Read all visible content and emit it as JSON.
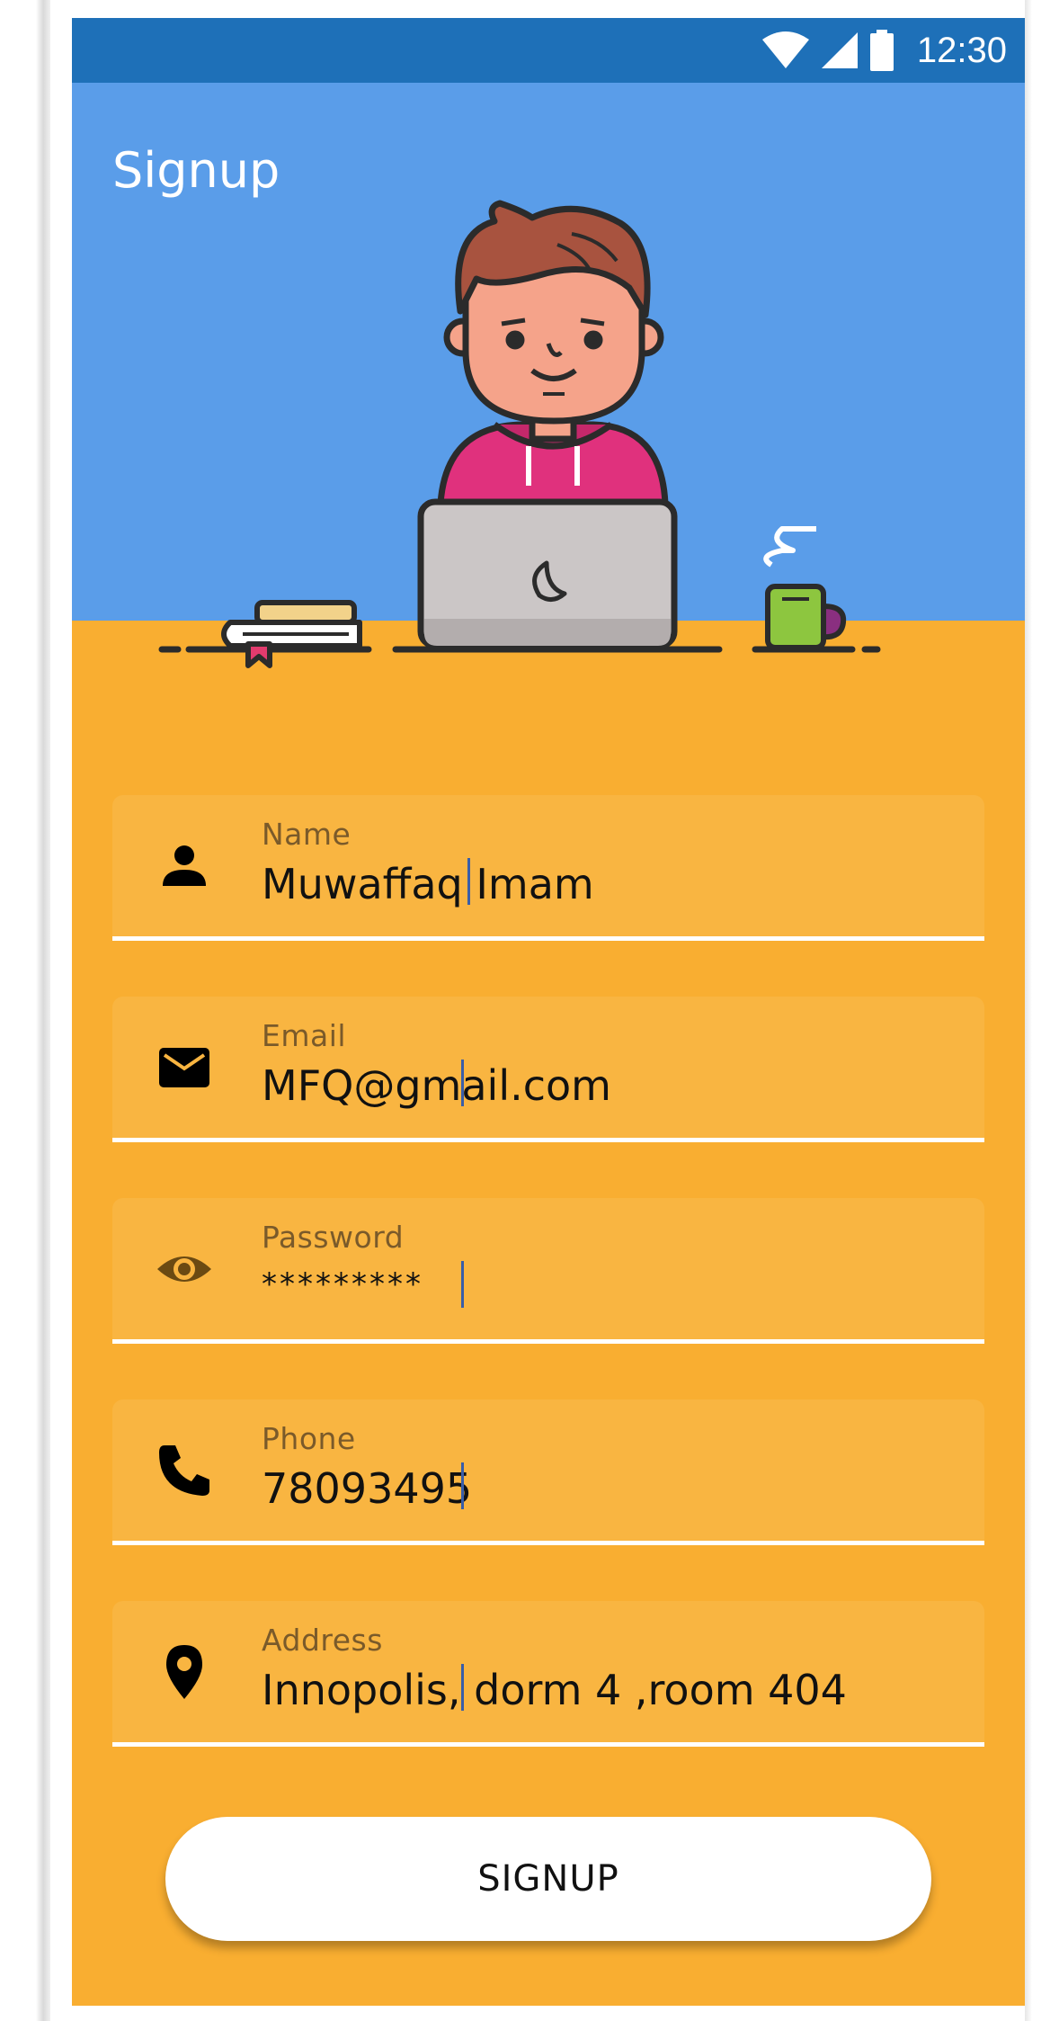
{
  "status_bar": {
    "time": "12:30",
    "icons": [
      "wifi-icon",
      "signal-icon",
      "battery-icon"
    ]
  },
  "header": {
    "title": "Signup"
  },
  "form": {
    "fields": [
      {
        "label": "Name",
        "value": "Muwaffaq Imam",
        "icon": "person-icon"
      },
      {
        "label": "Email",
        "value": "MFQ@gmail.com",
        "icon": "mail-icon"
      },
      {
        "label": "Password",
        "value": "*********",
        "icon": "eye-icon"
      },
      {
        "label": "Phone",
        "value": "78093495",
        "icon": "phone-icon"
      },
      {
        "label": "Address",
        "value": "Innopolis, dorm 4 ,room 404",
        "icon": "location-pin-icon"
      }
    ],
    "submit_label": "SIGNUP"
  },
  "colors": {
    "status_bar": "#1e70b8",
    "hero_background": "#5a9de9",
    "form_background": "#f9ae31",
    "field_background": "#f9b541",
    "button": "#ffffff"
  }
}
